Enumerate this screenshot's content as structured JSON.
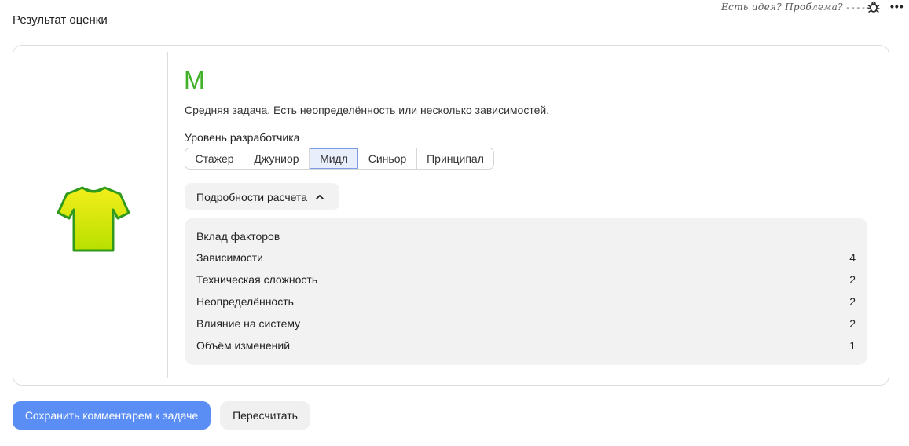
{
  "page": {
    "title": "Результат оценки"
  },
  "feedback": {
    "text": "Есть идея? Проблема?",
    "arrow": "----→"
  },
  "result": {
    "size": "M",
    "size_color": "#43b02a",
    "description": "Средняя задача. Есть неопределённость или несколько зависимостей.",
    "icon": "t-shirt-icon"
  },
  "level": {
    "label": "Уровень разработчика",
    "options": [
      "Стажер",
      "Джуниор",
      "Мидл",
      "Синьор",
      "Принципал"
    ],
    "selected": "Мидл"
  },
  "details": {
    "toggle_label": "Подробности расчета",
    "expanded": true,
    "title": "Вклад факторов",
    "factors": [
      {
        "name": "Зависимости",
        "value": "4"
      },
      {
        "name": "Техническая сложность",
        "value": "2"
      },
      {
        "name": "Неопределённость",
        "value": "2"
      },
      {
        "name": "Влияние на систему",
        "value": "2"
      },
      {
        "name": "Объём изменений",
        "value": "1"
      }
    ]
  },
  "actions": {
    "save_label": "Сохранить комментарем к задаче",
    "recalc_label": "Пересчитать",
    "primary_color": "#5b8ef5"
  }
}
